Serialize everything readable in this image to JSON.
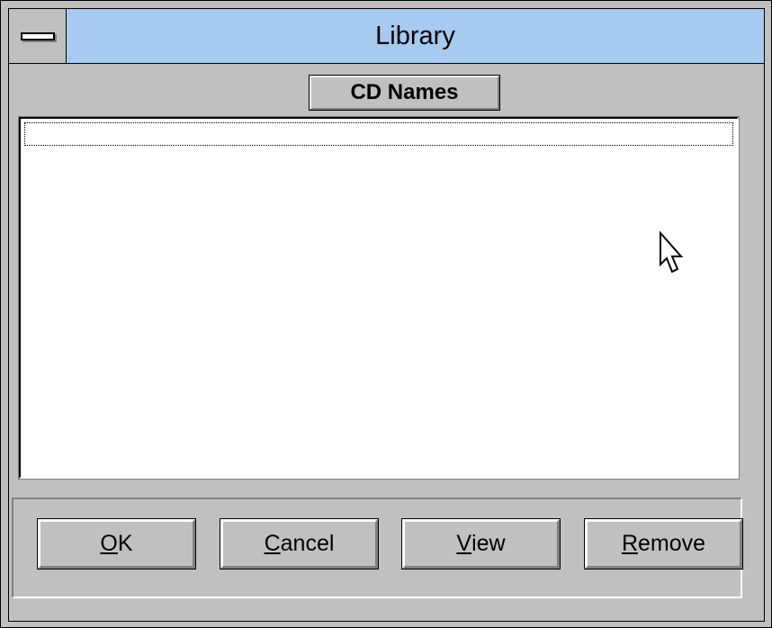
{
  "window": {
    "title": "Library"
  },
  "list": {
    "header_label": "CD Names",
    "items": []
  },
  "buttons": [
    {
      "mnemonic": "O",
      "rest": "K"
    },
    {
      "mnemonic": "C",
      "rest": "ancel"
    },
    {
      "mnemonic": "V",
      "rest": "iew"
    },
    {
      "mnemonic": "R",
      "rest": "emove"
    }
  ],
  "icons": {
    "system_menu": "system-menu-icon",
    "cursor": "mouse-pointer-icon"
  },
  "colors": {
    "titlebar": "#a6caf0",
    "face": "#c0c0c0",
    "list_background": "#ffffff"
  }
}
